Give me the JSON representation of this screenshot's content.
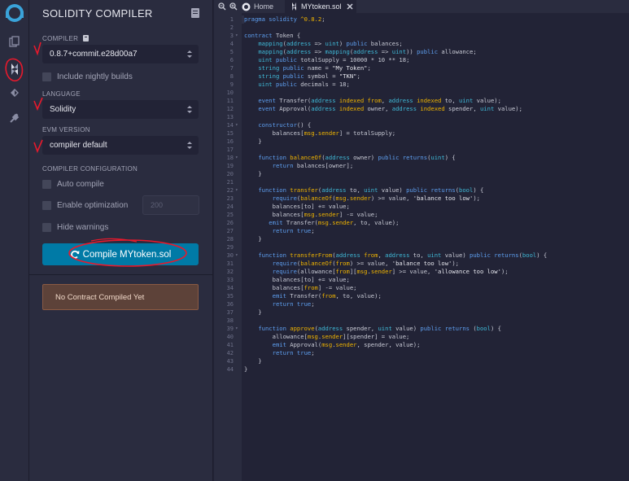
{
  "panel": {
    "title": "SOLIDITY COMPILER",
    "compiler_label": "COMPILER",
    "compiler_version": "0.8.7+commit.e28d00a7",
    "include_nightly_label": "Include nightly builds",
    "language_label": "LANGUAGE",
    "language_value": "Solidity",
    "evm_label": "EVM VERSION",
    "evm_value": "compiler default",
    "config_label": "COMPILER CONFIGURATION",
    "auto_compile_label": "Auto compile",
    "enable_opt_label": "Enable optimization",
    "runs_value": "200",
    "hide_warnings_label": "Hide warnings",
    "compile_button": "Compile MYtoken.sol",
    "status": "No Contract Compiled Yet"
  },
  "editor": {
    "tabs": [
      {
        "label": "Home"
      },
      {
        "label": "MYtoken.sol"
      }
    ],
    "line_numbers": [
      "1",
      "2",
      "3",
      "4",
      "5",
      "6",
      "7",
      "8",
      "9",
      "10",
      "11",
      "12",
      "13",
      "14",
      "15",
      "16",
      "17",
      "18",
      "19",
      "20",
      "21",
      "22",
      "23",
      "24",
      "25",
      "26",
      "27",
      "28",
      "29",
      "30",
      "31",
      "32",
      "33",
      "34",
      "35",
      "36",
      "37",
      "38",
      "39",
      "40",
      "41",
      "42",
      "43",
      "44"
    ],
    "fold_lines": [
      3,
      14,
      18,
      22,
      30,
      39
    ]
  },
  "colors": {
    "accent": "#007aa6",
    "panel_bg": "#2a2c3f",
    "editor_bg": "#222336",
    "annotation_red": "#e8192c"
  },
  "icons": [
    "remix-logo-icon",
    "file-explorer-icon",
    "solidity-compiler-icon",
    "deploy-run-icon",
    "plugin-icon",
    "document-icon",
    "copy-icon",
    "zoom-out-icon",
    "zoom-in-icon",
    "home-icon",
    "close-icon",
    "refresh-icon"
  ]
}
